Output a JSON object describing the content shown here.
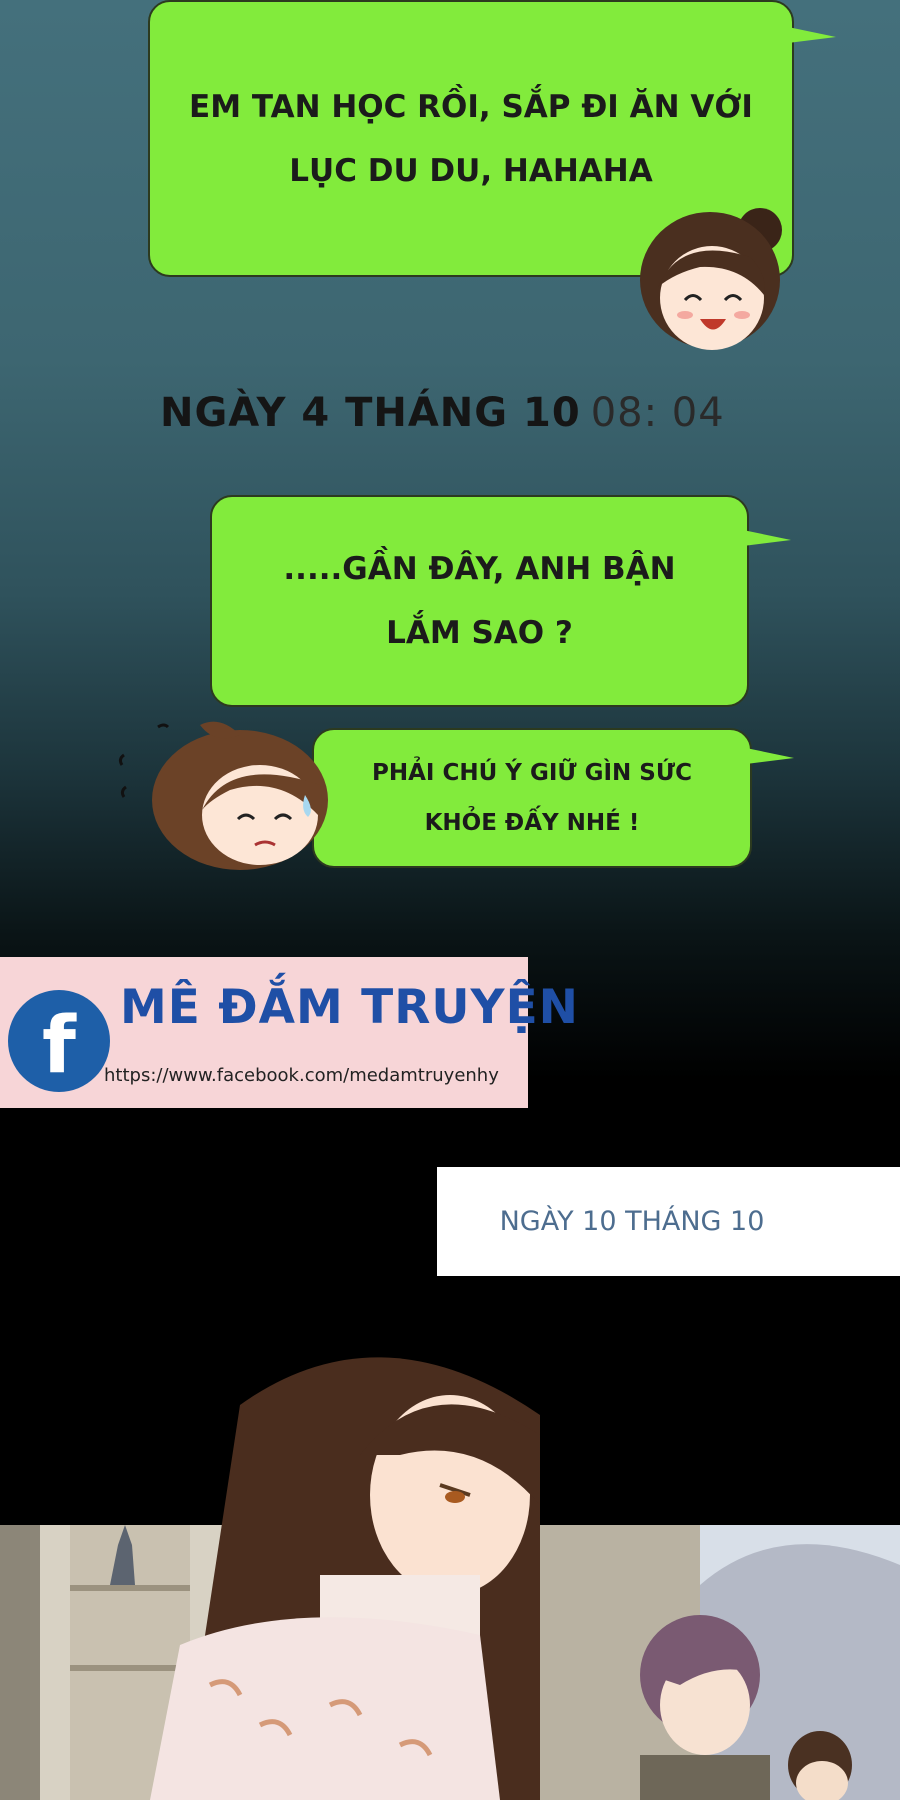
{
  "chat": {
    "message1": {
      "line1": "EM TAN HỌC RỒI, SẮP ĐI ĂN VỚI",
      "line2": "LỤC DU DU, HAHAHA"
    },
    "timestamp": {
      "date": "NGÀY 4 THÁNG 10",
      "time": "08:  04"
    },
    "message2": {
      "line1": ".....GẦN ĐÂY, ANH BẬN",
      "line2": "LẮM SAO ?"
    },
    "message3": {
      "line1": "PHẢI CHÚ Ý GIỮ GÌN SỨC",
      "line2": "KHỎE ĐẤY NHÉ !"
    }
  },
  "banner": {
    "logo_letter": "f",
    "title": "MÊ ĐẮM TRUYỆN",
    "url": "https://www.facebook.com/medamtruyenhy"
  },
  "caption": {
    "date": "NGÀY 10 THÁNG 10"
  },
  "colors": {
    "bubble": "#82eb3c",
    "banner_bg": "#f7d5d7",
    "facebook_blue": "#1e5fa8"
  }
}
